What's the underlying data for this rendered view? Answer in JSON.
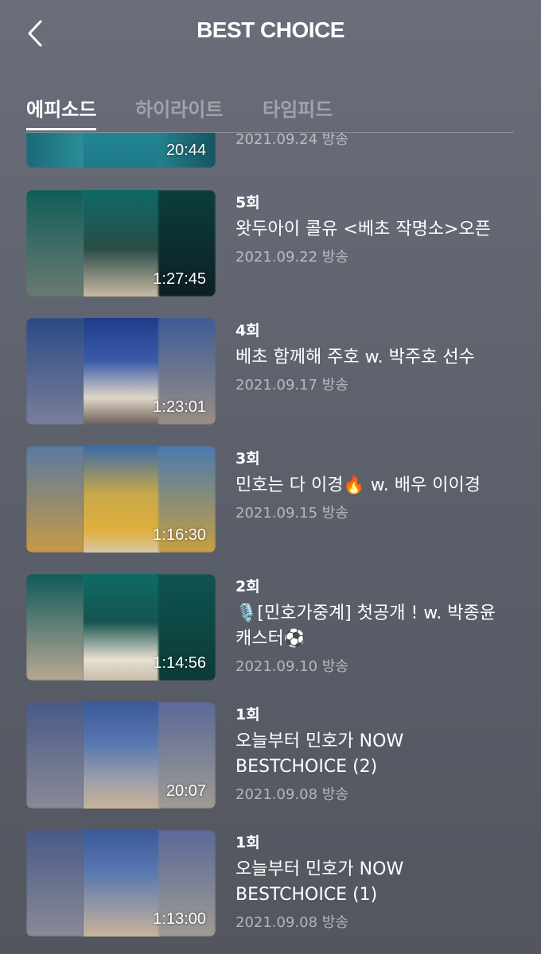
{
  "header": {
    "title": "BEST CHOICE",
    "back_icon": "chevron-left-icon"
  },
  "tabs": [
    {
      "label": "에피소드",
      "active": true
    },
    {
      "label": "하이라이트",
      "active": false
    },
    {
      "label": "타임피드",
      "active": false
    }
  ],
  "episodes": [
    {
      "ep": "",
      "title": "",
      "date": "2021.09.24 방송",
      "duration": "20:44",
      "partial": true
    },
    {
      "ep": "5회",
      "title": "왓두아이 콜유 <베초 작명소>오픈",
      "date": "2021.09.22 방송",
      "duration": "1:27:45"
    },
    {
      "ep": "4회",
      "title": "베초 함께해 주호 w. 박주호 선수",
      "date": "2021.09.17 방송",
      "duration": "1:23:01"
    },
    {
      "ep": "3회",
      "title": "민호는 다 이경🔥 w. 배우 이이경",
      "date": "2021.09.15 방송",
      "duration": "1:16:30"
    },
    {
      "ep": "2회",
      "title": "🎙️[민호가중계] 첫공개 ! w. 박종윤 캐스터⚽",
      "date": "2021.09.10 방송",
      "duration": "1:14:56"
    },
    {
      "ep": "1회",
      "title": "오늘부터 민호가 NOW BESTCHOICE (2)",
      "date": "2021.09.08 방송",
      "duration": "20:07"
    },
    {
      "ep": "1회",
      "title": "오늘부터 민호가 NOW BESTCHOICE (1)",
      "date": "2021.09.08 방송",
      "duration": "1:13:00"
    }
  ]
}
